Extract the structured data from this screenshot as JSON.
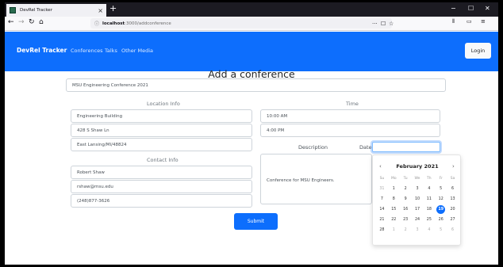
{
  "browser": {
    "tab_title": "DevRel Tracker",
    "new_tab": "+",
    "url_host": "localhost",
    "url_path": ":3000/addconference",
    "win_min": "−",
    "win_max": "☐",
    "win_close": "✕",
    "url_menu": "···",
    "url_pocket": "☐",
    "url_star": "☆"
  },
  "nav": {
    "brand": "DevRel Tracker",
    "links": [
      "Conferences",
      "Talks",
      "Other Media"
    ],
    "login": "Login"
  },
  "page": {
    "title": "Add a conference",
    "conference_name": "MSU Engineering Conference 2021",
    "location_label": "Location Info",
    "location": [
      "Engineering Building",
      "428 S Shaw Ln",
      "East Lansing/MI/48824"
    ],
    "contact_label": "Contact Info",
    "contact": [
      "Robert Shaw",
      "rshaw@msu.edu",
      "(248)877-3626"
    ],
    "time_label": "Time",
    "times": [
      "10:00 AM",
      "4:00 PM"
    ],
    "description_label": "Description",
    "description": "Conference for MSU Engineers.",
    "date_label": "Date",
    "submit": "Submit"
  },
  "datepicker": {
    "month": "February 2021",
    "prev": "‹",
    "next": "›",
    "weekdays": [
      "Su",
      "Mo",
      "Tu",
      "We",
      "Th",
      "Fr",
      "Sa"
    ],
    "weeks": [
      [
        "31",
        "1",
        "2",
        "3",
        "4",
        "5",
        "6"
      ],
      [
        "7",
        "8",
        "9",
        "10",
        "11",
        "12",
        "13"
      ],
      [
        "14",
        "15",
        "16",
        "17",
        "18",
        "19",
        "20"
      ],
      [
        "21",
        "22",
        "23",
        "24",
        "25",
        "26",
        "27"
      ],
      [
        "28",
        "1",
        "2",
        "3",
        "4",
        "5",
        "6"
      ]
    ],
    "selected": "19",
    "accent": "#0d6efd"
  }
}
